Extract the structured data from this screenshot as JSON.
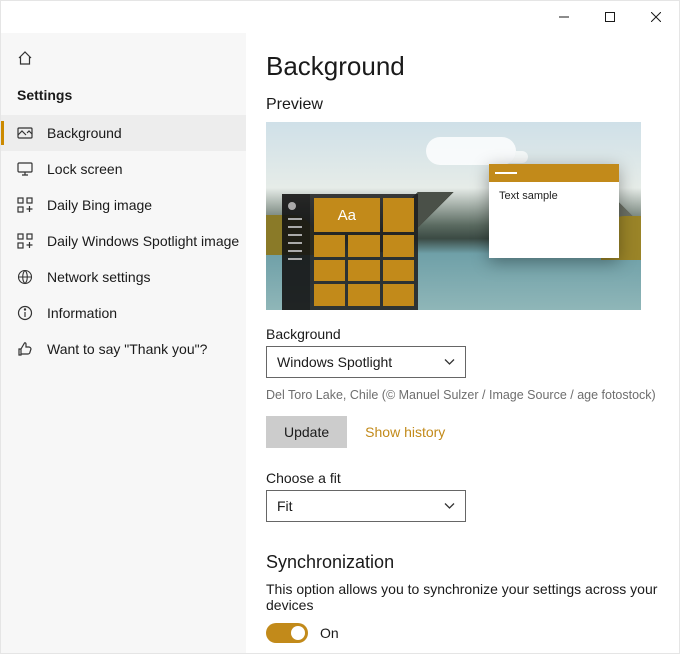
{
  "sidebar": {
    "header": "Settings",
    "items": [
      {
        "label": "Background",
        "icon": "picture-icon",
        "active": true
      },
      {
        "label": "Lock screen",
        "icon": "monitor-icon",
        "active": false
      },
      {
        "label": "Daily Bing image",
        "icon": "apps-icon",
        "active": false
      },
      {
        "label": "Daily Windows Spotlight image",
        "icon": "apps-icon",
        "active": false
      },
      {
        "label": "Network settings",
        "icon": "globe-icon",
        "active": false
      },
      {
        "label": "Information",
        "icon": "info-icon",
        "active": false
      },
      {
        "label": "Want to say \"Thank you\"?",
        "icon": "thumbs-up-icon",
        "active": false
      }
    ]
  },
  "main": {
    "title": "Background",
    "preview_label": "Preview",
    "preview_window_text": "Text sample",
    "preview_tile_text": "Aa",
    "background": {
      "label": "Background",
      "selected": "Windows Spotlight",
      "caption": "Del Toro Lake, Chile (© Manuel Sulzer / Image Source / age fotostock)"
    },
    "update_btn": "Update",
    "show_history_link": "Show history",
    "fit": {
      "label": "Choose a fit",
      "selected": "Fit"
    },
    "sync": {
      "title": "Synchronization",
      "description": "This option allows you to synchronize your settings across your devices",
      "state": "On"
    }
  }
}
